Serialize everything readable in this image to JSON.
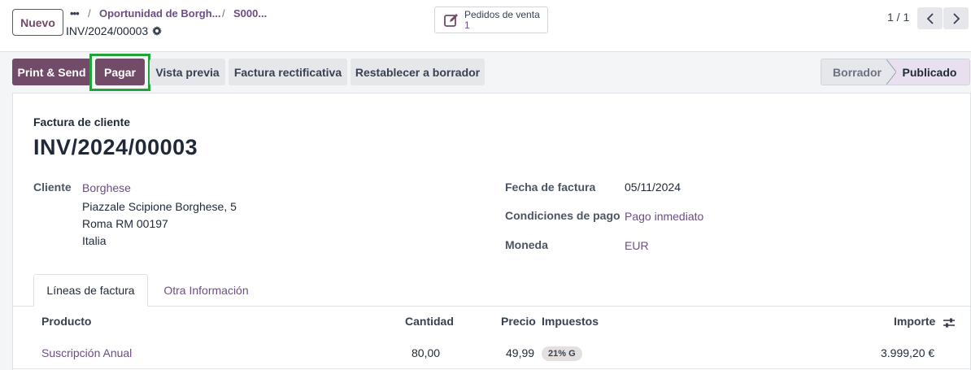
{
  "control_panel": {
    "new_button": "Nuevo",
    "breadcrumb_dots": "•••",
    "breadcrumb": [
      {
        "label": "Oportunidad de Borgh..."
      },
      {
        "label": "S000..."
      }
    ],
    "breadcrumb_sep": "/",
    "record_name": "INV/2024/00003",
    "smart_button": {
      "label": "Pedidos de venta",
      "count": "1",
      "icon": "edit-icon"
    },
    "pager": "1 / 1"
  },
  "actions": {
    "print_send": "Print & Send",
    "pay": "Pagar",
    "preview": "Vista previa",
    "credit_note": "Factura rectificativa",
    "reset_draft": "Restablecer a borrador"
  },
  "status_bar": {
    "draft": "Borrador",
    "posted": "Publicado",
    "current": "Publicado"
  },
  "invoice": {
    "type": "Factura de cliente",
    "number": "INV/2024/00003",
    "customer_label": "Cliente",
    "customer_name": "Borghese",
    "address_line1": "Piazzale Scipione Borghese, 5",
    "address_line2": "Roma RM 00197",
    "address_line3": "Italia",
    "date_label": "Fecha de factura",
    "date": "05/11/2024",
    "terms_label": "Condiciones de pago",
    "terms": "Pago inmediato",
    "currency_label": "Moneda",
    "currency": "EUR"
  },
  "tabs": {
    "lines": "Líneas de factura",
    "other": "Otra Información"
  },
  "table": {
    "headers": {
      "product": "Producto",
      "quantity": "Cantidad",
      "price": "Precio",
      "taxes": "Impuestos",
      "amount": "Importe"
    },
    "rows": [
      {
        "product": "Suscripción Anual",
        "quantity": "80,00",
        "price": "49,99",
        "tax": "21% G",
        "amount": "3.999,20 €"
      }
    ]
  },
  "colors": {
    "brand": "#714B67",
    "link": "#6B4D83",
    "highlight": "#1fa33a"
  }
}
